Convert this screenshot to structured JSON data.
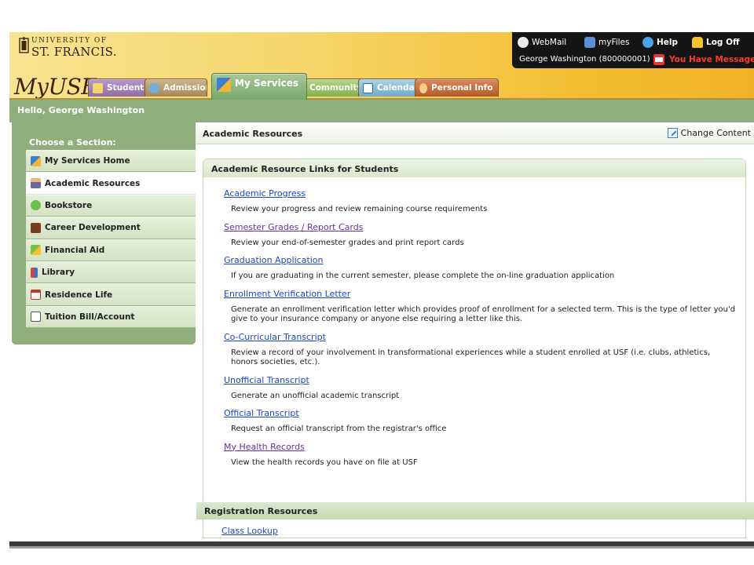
{
  "header": {
    "logo": {
      "line1": "UNIVERSITY OF",
      "line2": "ST. FRANCIS."
    },
    "brand": "MyUSF"
  },
  "utility": {
    "webmail": "WebMail",
    "myfiles": "myFiles",
    "help": "Help",
    "logoff": "Log Off",
    "user": "George Washington (800000001)",
    "messages": "You Have Messages",
    "colors": {
      "background": "#151515",
      "alert": "#ff3a2a"
    }
  },
  "tabs": [
    {
      "label": "Students",
      "icon": "students-icon",
      "color": "#9c7bb0"
    },
    {
      "label": "Admissions",
      "icon": "admissions-icon",
      "color": "#b89a6e"
    },
    {
      "label": "My Services",
      "icon": "my-services-icon",
      "color": "#7aa86a",
      "active": true
    },
    {
      "label": "Community",
      "icon": "community-icon",
      "color": "#9cc26b"
    },
    {
      "label": "Calendar",
      "icon": "calendar-icon",
      "color": "#8fc1d9"
    },
    {
      "label": "Personal Info",
      "icon": "personal-info-icon",
      "color": "#c56a3a"
    }
  ],
  "greeting": "Hello, George Washington",
  "sidebar": {
    "heading": "Choose a Section:",
    "items": [
      {
        "label": "My Services Home",
        "icon": "my-services-home-icon"
      },
      {
        "label": "Academic Resources",
        "icon": "academic-resources-icon",
        "active": true
      },
      {
        "label": "Bookstore",
        "icon": "bookstore-icon"
      },
      {
        "label": "Career Development",
        "icon": "career-development-icon"
      },
      {
        "label": "Financial Aid",
        "icon": "financial-aid-icon"
      },
      {
        "label": "Library",
        "icon": "library-icon"
      },
      {
        "label": "Residence Life",
        "icon": "residence-life-icon"
      },
      {
        "label": "Tuition Bill/Account",
        "icon": "tuition-bill-icon"
      }
    ]
  },
  "content": {
    "title": "Academic Resources",
    "change_content": "Change Content",
    "panel_title": "Academic Resource Links for Students",
    "resources": [
      {
        "link": "Academic Progress",
        "desc": "Review your progress and review remaining course requirements"
      },
      {
        "link": "Semester Grades / Report Cards",
        "desc": "Review your end-of-semester grades and print report cards",
        "visited": true
      },
      {
        "link": "Graduation Application",
        "desc": "If you are graduating in the current semester, please complete the on-line graduation application"
      },
      {
        "link": "Enrollment Verification Letter",
        "desc": "Generate an enrollment verification letter which provides proof of enrollment for a selected term. This is the type of letter you'd give to your insurance company or anyone else requiring a letter like this."
      },
      {
        "link": "Co-Curricular Transcript",
        "desc": "Review a record of your involvement in transformational experiences while a student enrolled at USF (i.e. clubs, athletics, honors societies, etc.)."
      },
      {
        "link": "Unofficial Transcript",
        "desc": "Generate an unofficial academic transcript"
      },
      {
        "link": "Official Transcript",
        "desc": "Request an official transcript from the registrar's office"
      },
      {
        "link": "My Health Records",
        "desc": "View the health records you have on file at USF",
        "visited": true
      }
    ],
    "registration": {
      "title": "Registration Resources",
      "first_link": "Class Lookup"
    }
  }
}
